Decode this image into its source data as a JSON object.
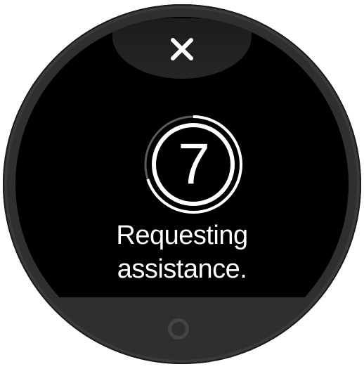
{
  "screen": {
    "close_icon": "close-icon",
    "countdown": {
      "value": "7",
      "progress": 0.7
    },
    "message": {
      "line1": "Requesting",
      "line2": "assistance."
    },
    "home_icon": "circle-home-icon"
  },
  "colors": {
    "screen_background": "#000000",
    "bezel": "#2f2f31",
    "text": "#ffffff",
    "ring": "#ffffff",
    "home_button": "#444446"
  }
}
